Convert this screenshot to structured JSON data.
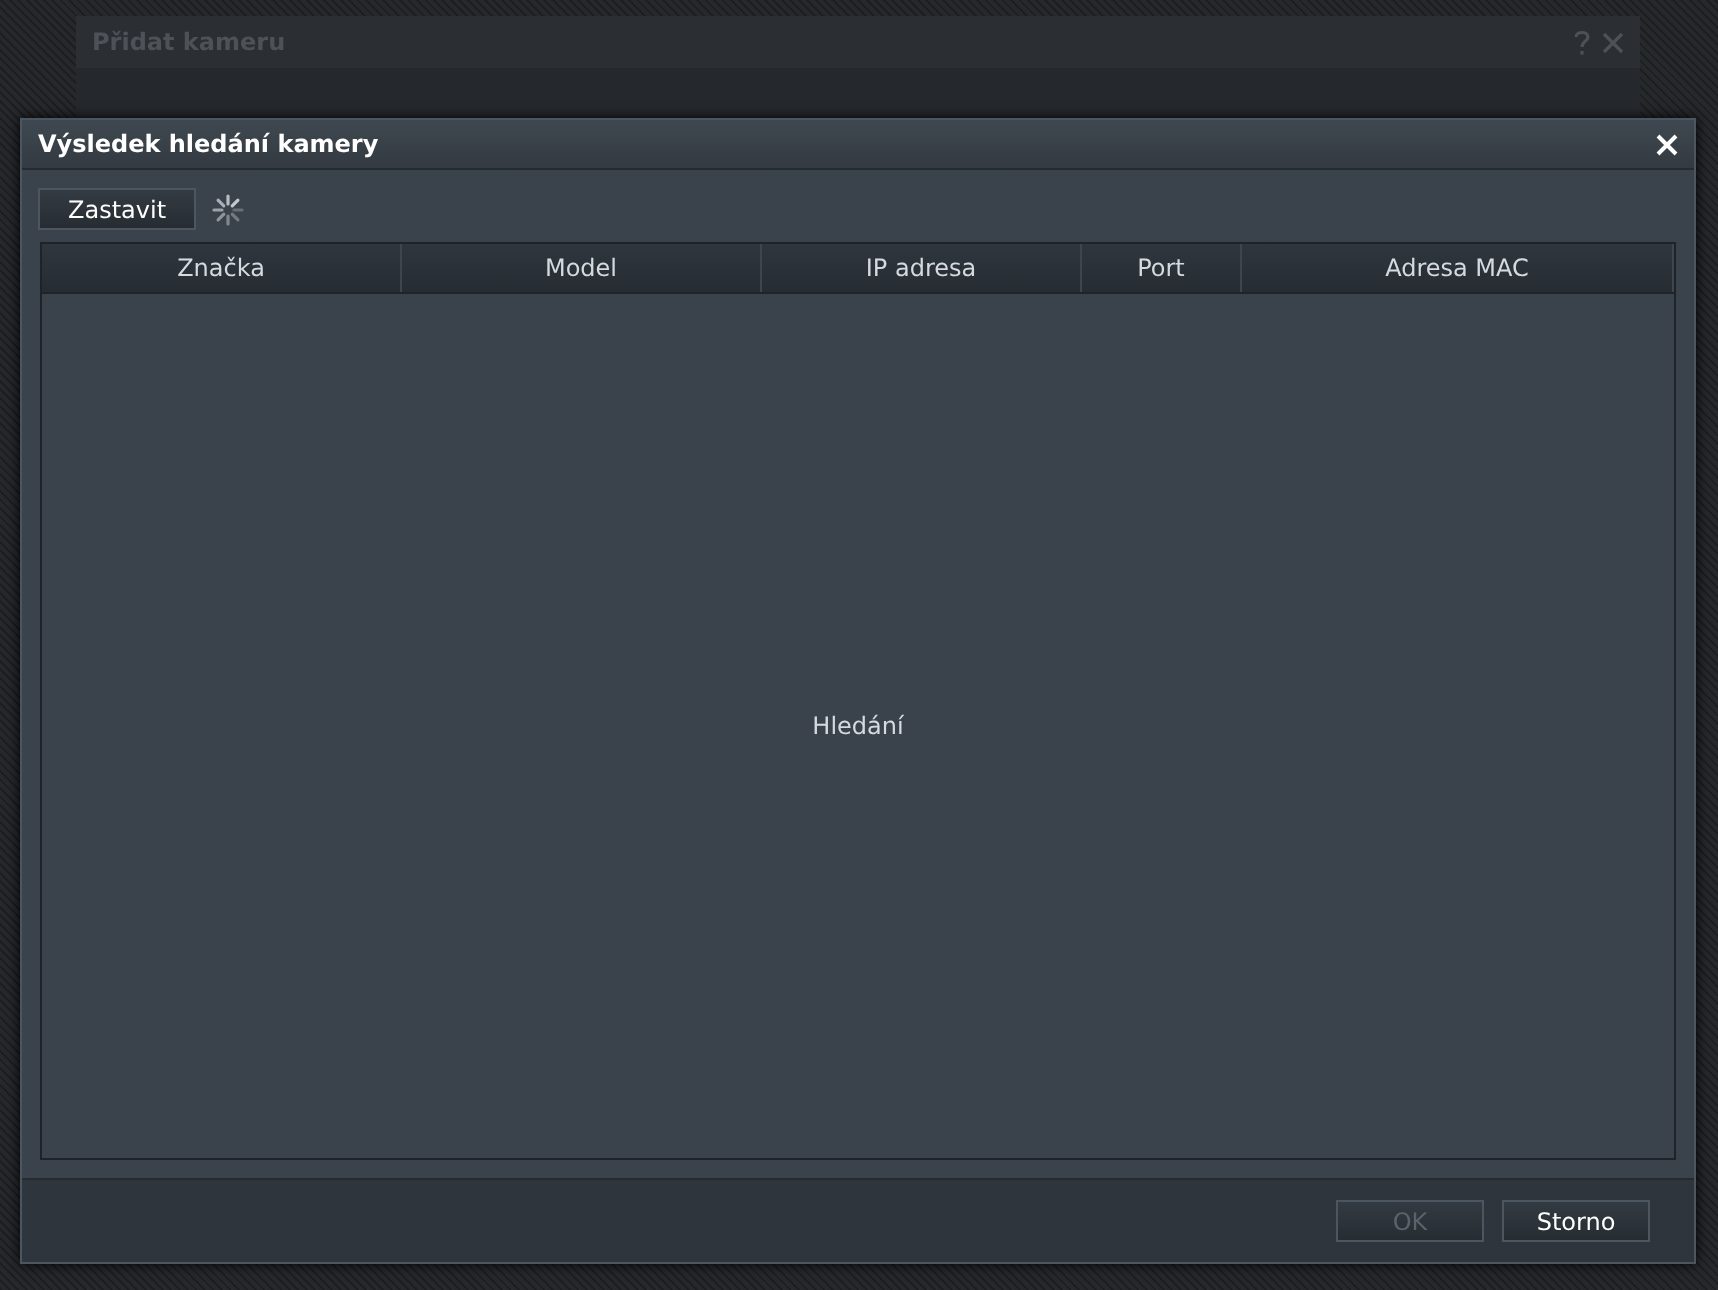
{
  "background_window": {
    "title": "Přidat kameru"
  },
  "dialog": {
    "title": "Výsledek hledání kamery"
  },
  "toolbar": {
    "stop_button": "Zastavit",
    "searching": true
  },
  "table": {
    "columns": [
      "Značka",
      "Model",
      "IP adresa",
      "Port",
      "Adresa MAC"
    ],
    "status": "Hledání"
  },
  "buttons": [
    {
      "label": "OK",
      "disabled": true
    },
    {
      "label": "Storno",
      "disabled": false
    }
  ]
}
